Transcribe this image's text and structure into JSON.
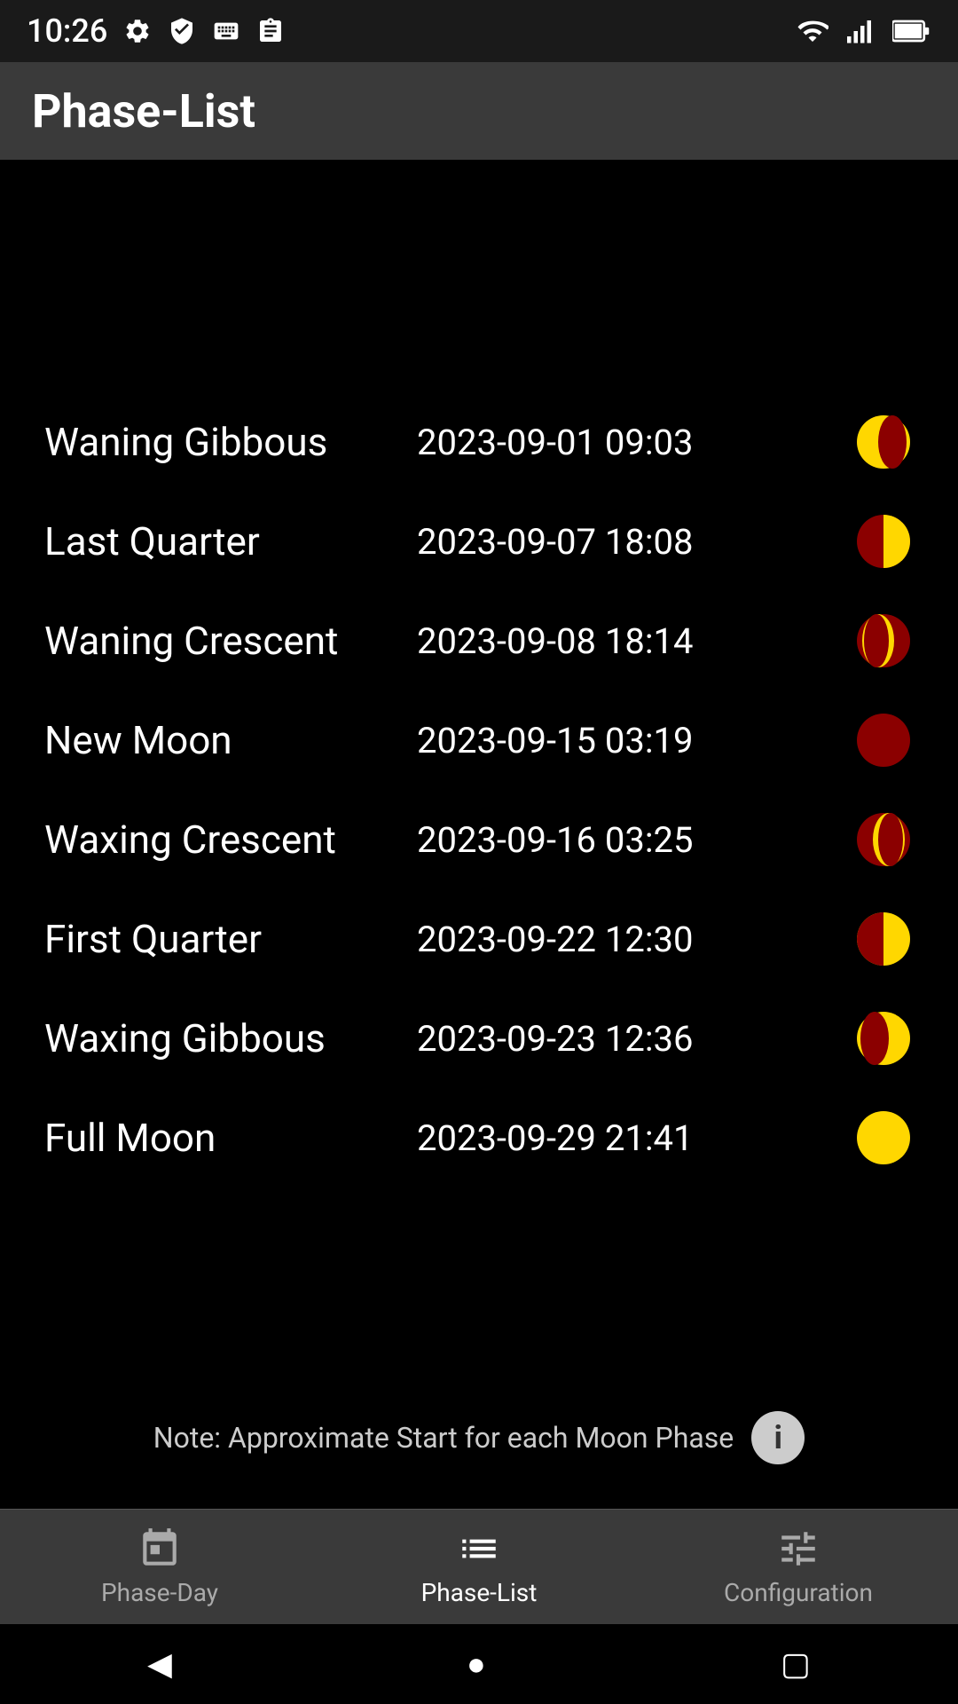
{
  "statusBar": {
    "time": "10:26",
    "icons": [
      "gear",
      "play",
      "keyboard",
      "clipboard",
      "wifi",
      "signal",
      "battery"
    ]
  },
  "appBar": {
    "title": "Phase-List"
  },
  "phaseList": {
    "items": [
      {
        "name": "Waning Gibbous",
        "date": "2023-09-01 09:03",
        "moonType": "waning-gibbous"
      },
      {
        "name": "Last Quarter",
        "date": "2023-09-07 18:08",
        "moonType": "last-quarter"
      },
      {
        "name": "Waning Crescent",
        "date": "2023-09-08 18:14",
        "moonType": "waning-crescent"
      },
      {
        "name": "New Moon",
        "date": "2023-09-15 03:19",
        "moonType": "new-moon"
      },
      {
        "name": "Waxing Crescent",
        "date": "2023-09-16 03:25",
        "moonType": "waxing-crescent"
      },
      {
        "name": "First Quarter",
        "date": "2023-09-22 12:30",
        "moonType": "first-quarter"
      },
      {
        "name": "Waxing Gibbous",
        "date": "2023-09-23 12:36",
        "moonType": "waxing-gibbous"
      },
      {
        "name": "Full Moon",
        "date": "2023-09-29 21:41",
        "moonType": "full-moon"
      }
    ]
  },
  "note": {
    "text": "Note: Approximate Start for each Moon Phase"
  },
  "bottomNav": {
    "items": [
      {
        "label": "Phase-Day",
        "icon": "calendar",
        "active": false
      },
      {
        "label": "Phase-List",
        "icon": "list",
        "active": true
      },
      {
        "label": "Configuration",
        "icon": "settings",
        "active": false
      }
    ]
  }
}
